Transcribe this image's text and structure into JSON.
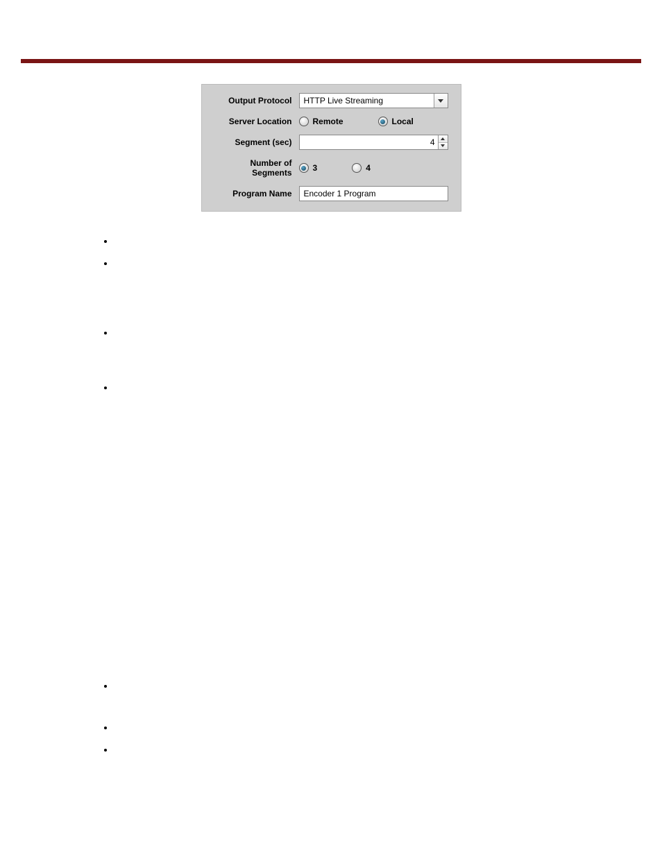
{
  "form": {
    "output_protocol": {
      "label": "Output Protocol",
      "value": "HTTP Live Streaming"
    },
    "server_location": {
      "label": "Server Location",
      "options": [
        {
          "label": "Remote",
          "selected": false
        },
        {
          "label": "Local",
          "selected": true
        }
      ]
    },
    "segment": {
      "label": "Segment (sec)",
      "value": "4"
    },
    "num_segments": {
      "label": "Number of Segments",
      "options": [
        {
          "label": "3",
          "selected": true
        },
        {
          "label": "4",
          "selected": false
        }
      ]
    },
    "program_name": {
      "label": "Program Name",
      "value": "Encoder 1 Program"
    }
  }
}
